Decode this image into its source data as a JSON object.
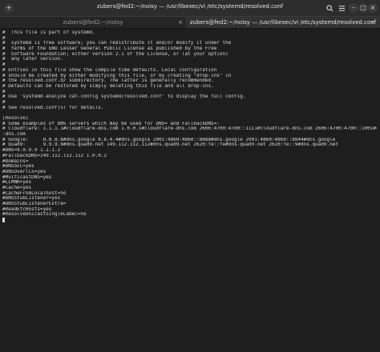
{
  "window": {
    "title": "zubers@fed2:~/noisy — /usr/libexec/vi /etc/systemd/resolved.conf"
  },
  "tabs": [
    {
      "label": "zubers@fed2:~/noisy",
      "active": false
    },
    {
      "label": "zubers@fed2:~/noisy — /usr/libexec/vi /etc/systemd/resolved.conf",
      "active": true
    }
  ],
  "icons": {
    "new_tab": "plus-icon",
    "search": "search-icon",
    "menu": "hamburger-menu-icon",
    "minimize": "minimize-icon",
    "maximize": "maximize-icon",
    "close": "close-icon"
  },
  "terminal": {
    "lines": [
      "#  This file is part of systemd.",
      "#",
      "#  systemd is free software; you can redistribute it and/or modify it under the",
      "#  terms of the GNU Lesser General Public License as published by the Free",
      "#  Software Foundation; either version 2.1 of the License, or (at your option)",
      "#  any later version.",
      "#",
      "# Entries in this file show the compile time defaults. Local configuration",
      "# should be created by either modifying this file, or by creating \"drop-ins\" in",
      "# the resolved.conf.d/ subdirectory. The latter is generally recommended.",
      "# Defaults can be restored by simply deleting this file and all drop-ins.",
      "#",
      "# Use 'systemd-analyze cat-config systemd/resolved.conf' to display the full config.",
      "#",
      "# See resolved.conf(5) for details.",
      "",
      "[Resolve]",
      "# Some examples of DNS servers which may be used for DNS= and FallbackDNS=:",
      "# Cloudflare: 1.1.1.1#cloudflare-dns.com 1.0.0.1#cloudflare-dns.com 2606:4700:4700::1111#cloudflare-dns.com 2606:4700:4700::1001#cloudflare",
      "-dns.com",
      "# Google:     8.8.8.8#dns.google 8.8.4.4#dns.google 2001:4860:4860::8888#dns.google 2001:4860:4860::8844#dns.google",
      "# Quad9:      9.9.9.9#dns.quad9.net 149.112.112.112#dns.quad9.net 2620:fe::fe#dns.quad9.net 2620:fe::9#dns.quad9.net",
      "#DNS=9.9.9.9 1.1.1.2",
      "#FallbackDNS=149.112.112.112 1.0.0.2",
      "#Domains=",
      "#DNSSEC=yes",
      "#DNSOverTLS=yes",
      "#MulticastDNS=yes",
      "#LLMNR=yes",
      "#Cache=yes",
      "#CacheFromLocalhost=no",
      "#DNSStubListener=yes",
      "#DNSStubListenerExtra=",
      "#ReadEtcHosts=yes",
      "#ResolveUnicastSingleLabel=no"
    ]
  }
}
